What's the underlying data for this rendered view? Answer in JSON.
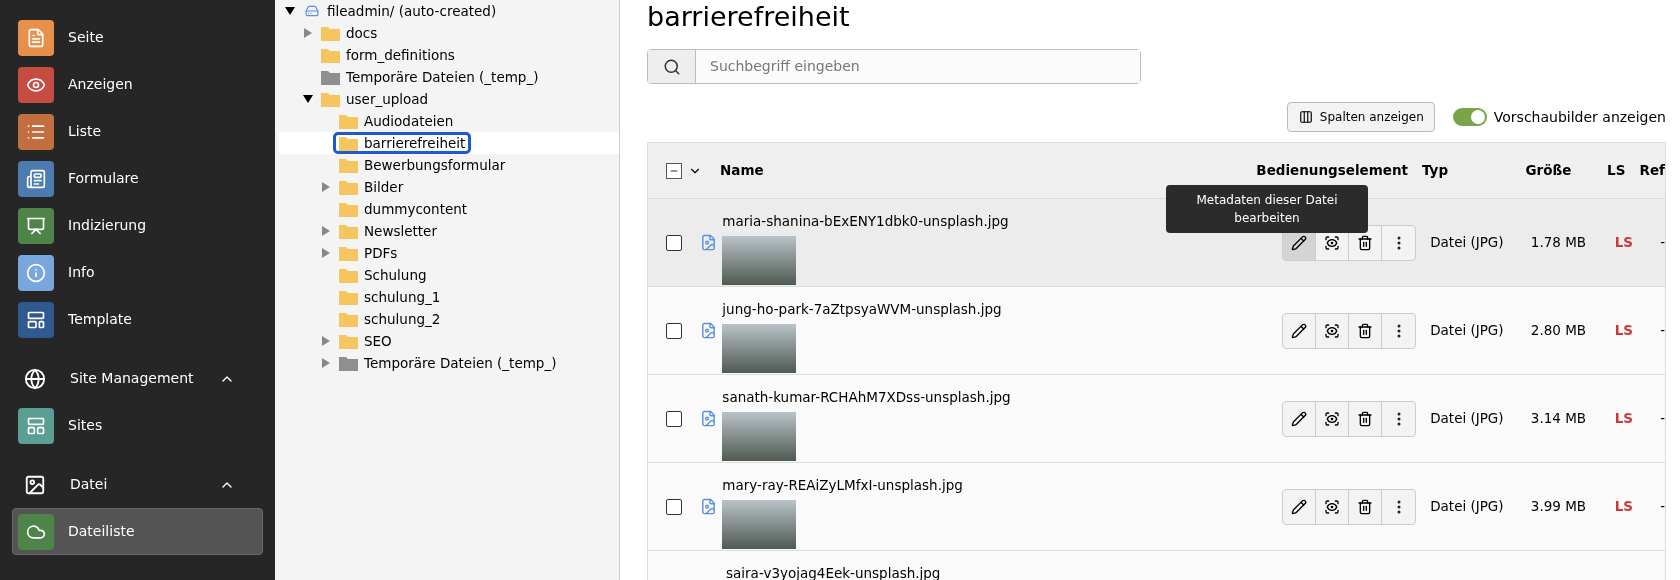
{
  "sidebar": {
    "items": [
      {
        "kind": "module",
        "label": "Seite",
        "color": "#e8904a",
        "selected": false
      },
      {
        "kind": "module",
        "label": "Anzeigen",
        "color": "#c64b41",
        "selected": false
      },
      {
        "kind": "module",
        "label": "Liste",
        "color": "#c26e3e",
        "selected": false
      },
      {
        "kind": "module",
        "label": "Formulare",
        "color": "#4c7bb0",
        "selected": false
      },
      {
        "kind": "module",
        "label": "Indizierung",
        "color": "#4f8448",
        "selected": false
      },
      {
        "kind": "module",
        "label": "Info",
        "color": "#79a7dd",
        "selected": false
      },
      {
        "kind": "module",
        "label": "Template",
        "color": "#2f5a90",
        "selected": false
      },
      {
        "kind": "group",
        "label": "Site Management",
        "expanded": true
      },
      {
        "kind": "module",
        "label": "Sites",
        "color": "#5a9e94",
        "selected": false
      },
      {
        "kind": "group",
        "label": "Datei",
        "expanded": true
      },
      {
        "kind": "module",
        "label": "Dateiliste",
        "color": "#4f8448",
        "selected": true
      }
    ]
  },
  "tree": {
    "nodes": [
      {
        "label": "fileadmin/ (auto-created)",
        "kind": "storage",
        "expanded": true,
        "selected": false,
        "children": [
          {
            "label": "docs",
            "kind": "folder",
            "expanded": false,
            "selected": false
          },
          {
            "label": "form_definitions",
            "kind": "folder",
            "selected": false
          },
          {
            "label": "Temporäre Dateien (_temp_)",
            "kind": "temp",
            "selected": false
          },
          {
            "label": "user_upload",
            "kind": "folder",
            "expanded": true,
            "selected": false,
            "children": [
              {
                "label": "Audiodateien",
                "kind": "folder",
                "selected": false
              },
              {
                "label": "barrierefreiheit",
                "kind": "folder",
                "selected": true
              },
              {
                "label": "Bewerbungsformular",
                "kind": "folder",
                "selected": false
              },
              {
                "label": "Bilder",
                "kind": "folder",
                "expanded": false,
                "selected": false
              },
              {
                "label": "dummycontent",
                "kind": "folder",
                "selected": false
              },
              {
                "label": "Newsletter",
                "kind": "folder",
                "expanded": false,
                "selected": false
              },
              {
                "label": "PDFs",
                "kind": "folder",
                "expanded": false,
                "selected": false
              },
              {
                "label": "Schulung",
                "kind": "folder",
                "selected": false
              },
              {
                "label": "schulung_1",
                "kind": "folder",
                "selected": false
              },
              {
                "label": "schulung_2",
                "kind": "folder",
                "selected": false
              },
              {
                "label": "SEO",
                "kind": "folder",
                "expanded": false,
                "selected": false
              },
              {
                "label": "Temporäre Dateien (_temp_)",
                "kind": "temp",
                "expanded": false,
                "selected": false
              }
            ]
          }
        ]
      }
    ]
  },
  "title": "barrierefreiheit",
  "search": {
    "placeholder": "Suchbegriff eingeben"
  },
  "columns_button": "Spalten anzeigen",
  "thumbnails_toggle": {
    "label": "Vorschaubilder anzeigen",
    "on": true
  },
  "table": {
    "select_all": {
      "indeterminate": true
    },
    "columns": [
      "Name",
      "Bedienungselement",
      "Typ",
      "Größe",
      "LS",
      "Ref"
    ],
    "rows": [
      {
        "name": "maria-shanina-bExENY1dbk0-unsplash.jpg",
        "type": "Datei (JPG)",
        "size": "1.78 MB",
        "ls": "LS",
        "ref": "-",
        "checked": false,
        "highlighted": true
      },
      {
        "name": "jung-ho-park-7aZtpsyaWVM-unsplash.jpg",
        "type": "Datei (JPG)",
        "size": "2.80 MB",
        "ls": "LS",
        "ref": "-",
        "checked": false,
        "highlighted": false
      },
      {
        "name": "sanath-kumar-RCHAhM7XDss-unsplash.jpg",
        "type": "Datei (JPG)",
        "size": "3.14 MB",
        "ls": "LS",
        "ref": "-",
        "checked": false,
        "highlighted": false
      },
      {
        "name": "mary-ray-REAiZyLMfxI-unsplash.jpg",
        "type": "Datei (JPG)",
        "size": "3.99 MB",
        "ls": "LS",
        "ref": "-",
        "checked": false,
        "highlighted": false
      },
      {
        "name": "saira-v3yojag4Eek-unsplash.jpg",
        "highlighted": false
      }
    ]
  },
  "tooltip": "Metadaten dieser Datei bearbeiten"
}
